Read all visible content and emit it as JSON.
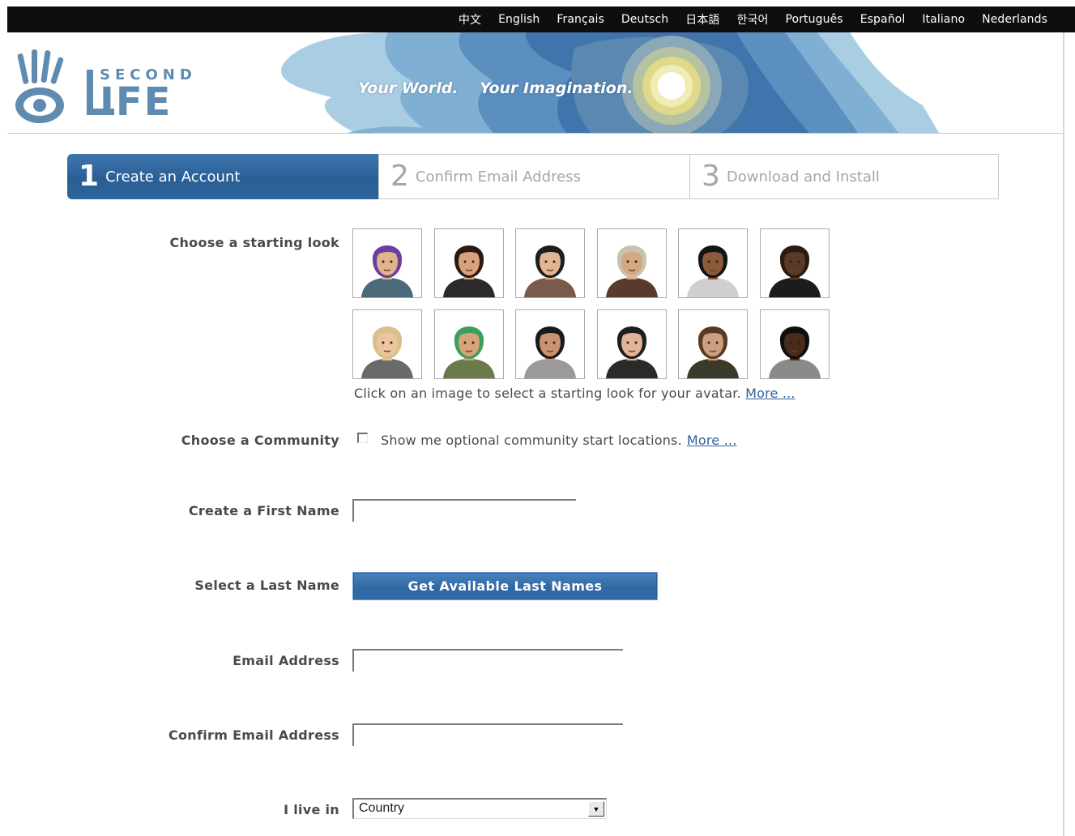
{
  "languages": [
    "中文",
    "English",
    "Français",
    "Deutsch",
    "日本語",
    "한국어",
    "Português",
    "Español",
    "Italiano",
    "Nederlands"
  ],
  "banner": {
    "logo_text": "SECOND LIFE",
    "tagline_part1": "Your World.",
    "tagline_part2": "Your Imagination."
  },
  "steps": [
    {
      "num": "1",
      "label": "Create an Account"
    },
    {
      "num": "2",
      "label": "Confirm Email Address"
    },
    {
      "num": "3",
      "label": "Download and Install"
    }
  ],
  "form": {
    "starting_look_label": "Choose a starting look",
    "avatar_help": "Click on an image to select a starting look for your avatar.",
    "more_link": "More ...",
    "community_label": "Choose a Community",
    "community_checkbox_text": "Show me optional community start locations.",
    "first_name_label": "Create a First Name",
    "first_name_value": "",
    "last_name_label": "Select a Last Name",
    "last_name_button": "Get Available Last Names",
    "email_label": "Email Address",
    "email_value": "",
    "confirm_email_label": "Confirm Email Address",
    "confirm_email_value": "",
    "country_label": "I live in",
    "country_selected": "Country"
  },
  "avatars": [
    {
      "name": "avatar-1",
      "skin": "#e0b48c",
      "hair": "#6b3fa0",
      "shirt": "#4a6a7a"
    },
    {
      "name": "avatar-2",
      "skin": "#d8a27a",
      "hair": "#2a1a12",
      "shirt": "#2a2a2a"
    },
    {
      "name": "avatar-3",
      "skin": "#e2b694",
      "hair": "#1e1e1e",
      "shirt": "#7a5a4a"
    },
    {
      "name": "avatar-4",
      "skin": "#d4a880",
      "hair": "#c8c2b0",
      "shirt": "#5a3a2a"
    },
    {
      "name": "avatar-5",
      "skin": "#8a5a3a",
      "hair": "#141414",
      "shirt": "#cfcfcf"
    },
    {
      "name": "avatar-6",
      "skin": "#5a3a26",
      "hair": "#2a1a10",
      "shirt": "#1c1c1c"
    },
    {
      "name": "avatar-7",
      "skin": "#ecc4a0",
      "hair": "#d8c08a",
      "shirt": "#6a6a6a"
    },
    {
      "name": "avatar-8",
      "skin": "#d8a27a",
      "hair": "#3aa05a",
      "shirt": "#6a7a4a"
    },
    {
      "name": "avatar-9",
      "skin": "#c99270",
      "hair": "#1a1a1a",
      "shirt": "#9a9a9a"
    },
    {
      "name": "avatar-10",
      "skin": "#e0b494",
      "hair": "#1e1e1e",
      "shirt": "#2a2a2a"
    },
    {
      "name": "avatar-11",
      "skin": "#caa080",
      "hair": "#5a3a22",
      "shirt": "#3a3a2a"
    },
    {
      "name": "avatar-12",
      "skin": "#4a2a1a",
      "hair": "#0e0e0e",
      "shirt": "#8a8a8a"
    }
  ],
  "colors": {
    "accent": "#2e6aa5",
    "link": "#2e5f9b",
    "langbar": "#0e0e0e"
  }
}
